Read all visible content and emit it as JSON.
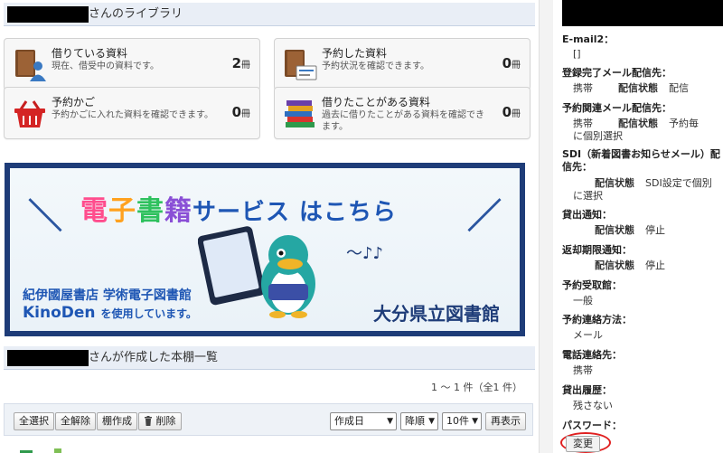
{
  "library": {
    "header_suffix": "さんのライブラリ",
    "cards": [
      {
        "title": "借りている資料",
        "desc": "現在、借受中の資料です。",
        "count": "2",
        "unit": "冊",
        "icon": "book-person-icon"
      },
      {
        "title": "予約した資料",
        "desc": "予約状況を確認できます。",
        "count": "0",
        "unit": "冊",
        "icon": "book-card-icon"
      },
      {
        "title": "予約かご",
        "desc": "予約かごに入れた資料を確認できます。",
        "count": "0",
        "unit": "冊",
        "icon": "basket-icon"
      },
      {
        "title": "借りたことがある資料",
        "desc": "過去に借りたことがある資料を確認できます。",
        "count": "0",
        "unit": "冊",
        "icon": "books-stack-icon"
      }
    ]
  },
  "banner": {
    "title_parts": [
      "電",
      "子",
      "書",
      "籍",
      "サービス はこちら"
    ],
    "line1": "紀伊國屋書店 学術電子図書館",
    "line2_brand": "KinoDen",
    "line2_rest": "を使用しています。",
    "library_name": "大分県立図書館",
    "music": "～♪♪"
  },
  "bookshelf": {
    "header_suffix": "さんが作成した本棚一覧",
    "pager": "1 ～ 1 件（全1 件）",
    "buttons": {
      "select_all": "全選択",
      "deselect_all": "全解除",
      "create_shelf": "棚作成",
      "delete": "削除"
    },
    "sort_field": "作成日",
    "sort_order": "降順",
    "per_page": "10件",
    "redisplay": "再表示"
  },
  "side": {
    "email2_label": "E-mail2：",
    "email2_value": "[]",
    "reg_mail_label": "登録完了メール配信先：",
    "reg_mail_a": "携帯",
    "reg_mail_b": "配信状態",
    "reg_mail_c": "配信",
    "resv_mail_label": "予約関連メール配信先：",
    "resv_mail_a": "携帯",
    "resv_mail_b": "配信状態",
    "resv_mail_c": "予約毎",
    "resv_mail_d": "に個別選択",
    "sdi_label": "SDI（新着図書お知らせメール）配信先：",
    "sdi_b": "配信状態",
    "sdi_c": "SDI設定で個別",
    "sdi_d": "に選択",
    "loan_label": "貸出通知：",
    "loan_b": "配信状態",
    "loan_c": "停止",
    "overdue_label": "返却期限通知：",
    "overdue_b": "配信状態",
    "overdue_c": "停止",
    "pickup_label": "予約受取館：",
    "pickup_value": "一般",
    "contact_label": "予約連絡方法：",
    "contact_value": "メール",
    "phone_label": "電話連絡先：",
    "phone_value": "携帯",
    "history_label": "貸出履歴：",
    "history_value": "残さない",
    "password_label": "パスワード：",
    "change_button": "変更"
  }
}
